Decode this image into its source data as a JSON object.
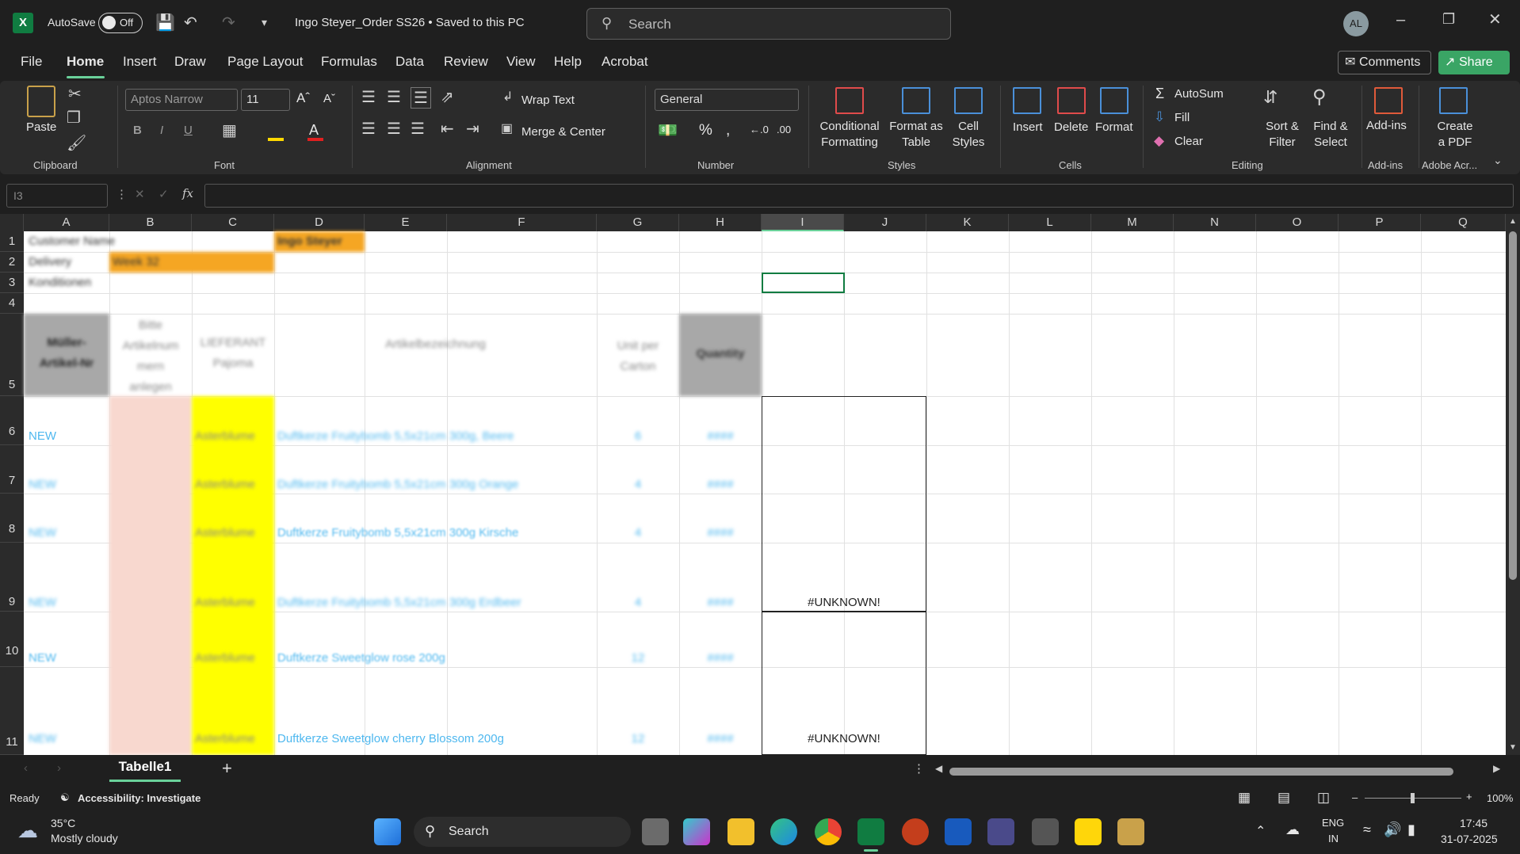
{
  "title_bar": {
    "autosave_label": "AutoSave",
    "autosave_state": "Off",
    "doc_title": "Ingo Steyer_Order SS26 • Saved to this PC",
    "search_placeholder": "Search",
    "avatar_initials": "AL"
  },
  "menu": {
    "items": [
      "File",
      "Home",
      "Insert",
      "Draw",
      "Page Layout",
      "Formulas",
      "Data",
      "Review",
      "View",
      "Help",
      "Acrobat"
    ],
    "active": "Home",
    "comments_label": "Comments",
    "share_label": "Share"
  },
  "ribbon": {
    "clipboard": {
      "paste": "Paste",
      "group": "Clipboard"
    },
    "font": {
      "family": "Aptos Narrow",
      "size": "11",
      "group": "Font"
    },
    "alignment": {
      "wrap_text": "Wrap Text",
      "merge_center": "Merge & Center",
      "group": "Alignment"
    },
    "number": {
      "format": "General",
      "group": "Number"
    },
    "styles": {
      "conditional": "Conditional\nFormatting",
      "format_table": "Format as\nTable",
      "cell_styles": "Cell\nStyles",
      "group": "Styles"
    },
    "cells": {
      "insert": "Insert",
      "delete": "Delete",
      "format": "Format",
      "group": "Cells"
    },
    "editing": {
      "autosum": "AutoSum",
      "fill": "Fill",
      "clear": "Clear",
      "sort": "Sort &\nFilter",
      "find": "Find &\nSelect",
      "group": "Editing"
    },
    "addins": {
      "label": "Add-ins",
      "group": "Add-ins"
    },
    "adobe": {
      "label": "Create\na PDF",
      "group": "Adobe Acr..."
    }
  },
  "formula_bar": {
    "name_box": "I3",
    "fx": "fx",
    "content": ""
  },
  "grid": {
    "columns": [
      "A",
      "B",
      "C",
      "D",
      "E",
      "F",
      "G",
      "H",
      "I",
      "J",
      "K",
      "L",
      "M",
      "N",
      "O",
      "P",
      "Q"
    ],
    "selected_column": "I",
    "rows": [
      "1",
      "2",
      "3",
      "4",
      "5",
      "6",
      "7",
      "8",
      "9",
      "10",
      "11"
    ],
    "cells": {
      "A1": "Customer Name",
      "D1": "Ingo Steyer",
      "A2": "Delivery",
      "B2": "Week 32",
      "A3": "Konditionen",
      "A5": "Müller-\nArtikel-Nr",
      "B5": "Bitte\nArtikelnum\nmern\nanlegen",
      "C5": "LIEFERANT\nPajoma",
      "D5": "Artikelbezeichnung",
      "G5": "Unit per\nCarton",
      "H5": "Quantity",
      "A6": "NEW",
      "C6": "Asterblume",
      "D6": "Duftkerze Fruitybomb 5,5x21cm 300g, Beere",
      "G6": "6",
      "H6": "####",
      "A7": "NEW",
      "C7": "Asterblume",
      "D7": "Duftkerze Fruitybomb 5,5x21cm 300g Orange",
      "G7": "4",
      "H7": "####",
      "A8": "NEW",
      "C8": "Asterblume",
      "D8": "Duftkerze Fruitybomb 5,5x21cm 300g Kirsche",
      "G8": "4",
      "H8": "####",
      "A9": "NEW",
      "C9": "Asterblume",
      "D9": "Duftkerze Fruitybomb 5,5x21cm 300g Erdbeer",
      "G9": "4",
      "H9": "####",
      "I9": "#UNKNOWN!",
      "A10": "NEW",
      "C10": "Asterblume",
      "D10": "Duftkerze Sweetglow rose 200g",
      "G10": "12",
      "H10": "####",
      "A11": "NEW",
      "C11": "Asterblume",
      "D11": "Duftkerze Sweetglow cherry Blossom 200g",
      "G11": "12",
      "H11": "####",
      "I11": "#UNKNOWN!"
    }
  },
  "sheet_tabs": {
    "active": "Tabelle1",
    "add": "+"
  },
  "status_bar": {
    "ready": "Ready",
    "accessibility": "Accessibility: Investigate",
    "zoom": "100%"
  },
  "taskbar": {
    "weather_temp": "35°C",
    "weather_desc": "Mostly cloudy",
    "search": "Search",
    "lang1": "ENG",
    "lang2": "IN",
    "time": "17:45",
    "date": "31-07-2025"
  },
  "colors": {
    "accent": "#6ad19a",
    "share": "#3aa565",
    "orange": "#f5a623",
    "yellow": "#ffff00",
    "pink": "#f8d8cf",
    "blue_text": "#4fb8ef"
  }
}
